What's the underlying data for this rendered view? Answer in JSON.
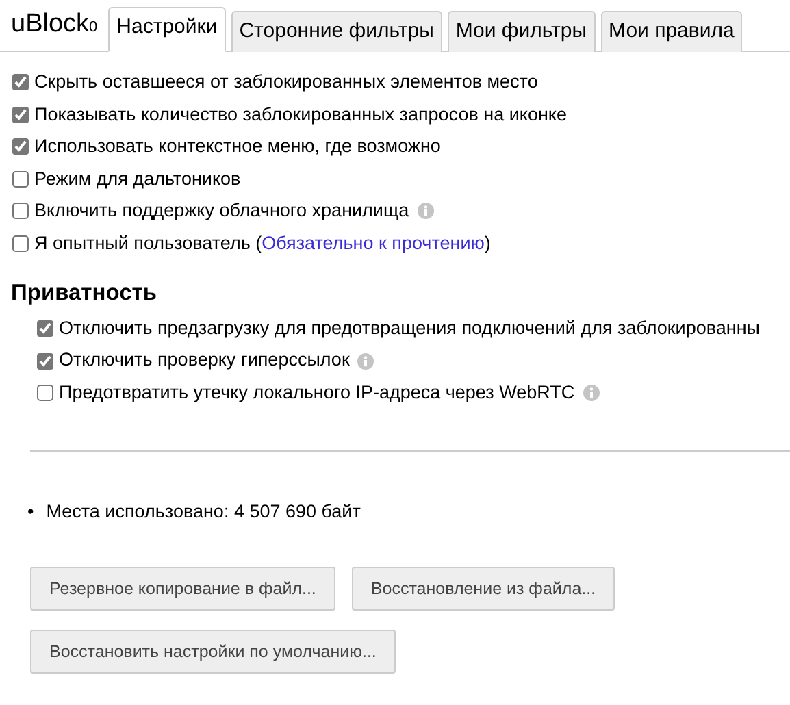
{
  "logo": "uBlock$_{0}$",
  "tabs": [
    {
      "label": "Настройки",
      "selected": true
    },
    {
      "label": "Сторонние фильтры",
      "selected": false
    },
    {
      "label": "Мои фильтры",
      "selected": false
    },
    {
      "label": "Мои правила",
      "selected": false
    }
  ],
  "options": [
    {
      "label": "Скрыть оставшееся от заблокированных элементов место",
      "checked": true,
      "info": false
    },
    {
      "label": "Показывать количество заблокированных запросов на иконке",
      "checked": true,
      "info": false
    },
    {
      "label": "Использовать контекстное меню, где возможно",
      "checked": true,
      "info": false
    },
    {
      "label": "Режим для дальтоников",
      "checked": false,
      "info": false
    },
    {
      "label": "Включить поддержку облачного хранилища",
      "checked": false,
      "info": true
    },
    {
      "label": "Я опытный пользователь (",
      "link": "Обязательно к прочтению",
      "label_end": ")",
      "checked": false,
      "info": false
    }
  ],
  "privacy": {
    "title": "Приватность",
    "options": [
      {
        "label": "Отключить предзагрузку для предотвращения подключений для заблокированны",
        "checked": true,
        "info": false
      },
      {
        "label": "Отключить проверку гиперссылок",
        "checked": true,
        "info": true
      },
      {
        "label": "Предотвратить утечку локального IP-адреса через WebRTC",
        "checked": false,
        "info": true
      }
    ]
  },
  "storage_bullet": "•",
  "storage": "Места использовано: 4 507 690 байт",
  "buttons": [
    [
      "Резервное копирование в файл...",
      "Восстановление из файла..."
    ],
    [
      "Восстановить настройки по умолчанию..."
    ]
  ]
}
